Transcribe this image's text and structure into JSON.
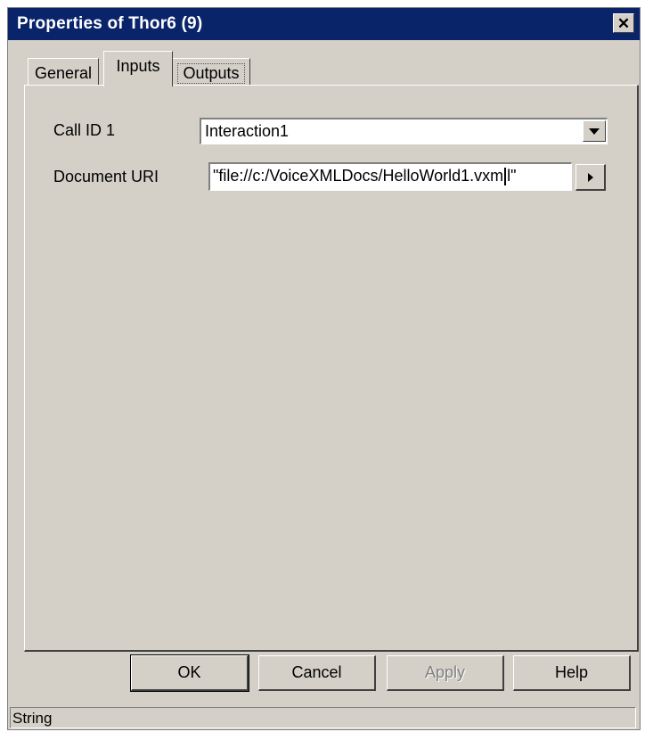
{
  "window": {
    "title": "Properties of Thor6 (9)",
    "close_glyph": "✕",
    "titlebar_color": "#0a246a"
  },
  "tabs": [
    {
      "label": "General",
      "selected": false
    },
    {
      "label": "Inputs",
      "selected": true
    },
    {
      "label": "Outputs",
      "selected": false
    }
  ],
  "inputs": {
    "call_id": {
      "label": "Call ID 1",
      "value": "Interaction1"
    },
    "document_uri": {
      "label": "Document URI",
      "value_before_caret": "\"file://c:/VoiceXMLDocs/HelloWorld1.vxm",
      "value_after_caret": "l\""
    }
  },
  "buttons": {
    "ok": "OK",
    "cancel": "Cancel",
    "apply": "Apply",
    "help": "Help"
  },
  "status": {
    "text": "String"
  },
  "icons": {
    "combo_dropdown": "chevron-down-icon",
    "expression_button": "triangle-right-icon",
    "close": "close-icon"
  }
}
